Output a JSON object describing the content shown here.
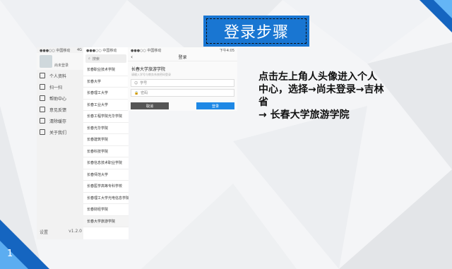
{
  "slide": {
    "title": "登录步骤",
    "page_number": "1",
    "instruction": "点击左上角人头像进入个人中心，选择→尚未登录→吉林省\n→ 长春大学旅游学院"
  },
  "phone1": {
    "status_left": "●●●○○ 中国移动",
    "status_right": "4G",
    "user_label": "尚未登录",
    "menu": [
      "个人资料",
      "扫一扫",
      "帮助中心",
      "意见反馈",
      "清除缓存",
      "关于我们"
    ],
    "bottom_left": "设置",
    "bottom_right": "v1.2.0"
  },
  "phone2": {
    "status_left": "●●●○○ 中国移动",
    "search_label": "搜索",
    "schools": [
      "长春职业技术学院",
      "长春大学",
      "长春理工大学",
      "长春工业大学",
      "长春工程学院光华学院",
      "长春光华学院",
      "长春建筑学院",
      "长春科技学院",
      "长春信息技术职业学院",
      "长春师范大学",
      "长春医学高等专科学校",
      "长春理工大学光电信息学院",
      "长春财经学院",
      "长春大学旅游学院"
    ]
  },
  "phone3": {
    "status_left": "●●●○○ 中国移动",
    "status_right": "下午4:05",
    "nav_title": "登录",
    "back": "‹",
    "school_title": "长春大学旅游学院",
    "hint": "请输入学号与教务系统密码登录",
    "fields": [
      {
        "icon": "person-icon",
        "placeholder": "学号"
      },
      {
        "icon": "lock-icon",
        "placeholder": "密码"
      }
    ],
    "btn_left": "取消",
    "btn_right": "登录"
  },
  "colors": {
    "accent": "#1976d2",
    "accent_light": "#64b5f6"
  }
}
